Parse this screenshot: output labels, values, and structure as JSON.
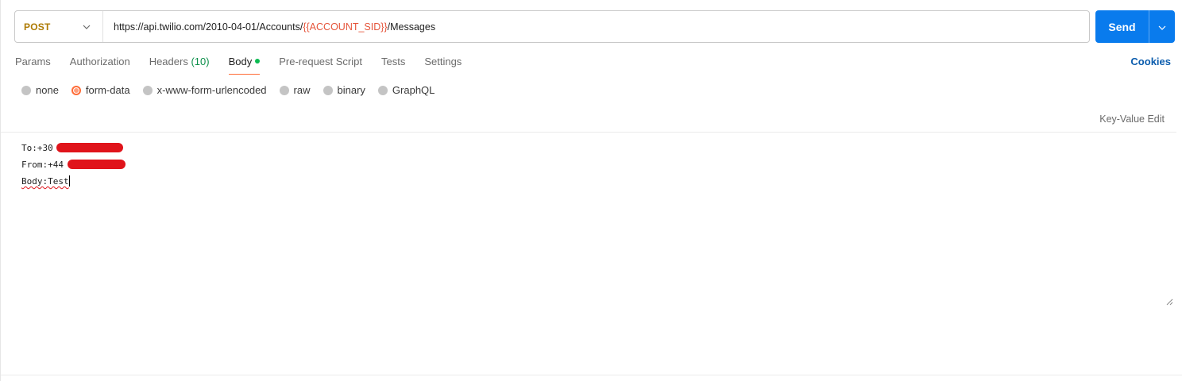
{
  "request": {
    "method": "POST",
    "url_prefix": "https://api.twilio.com/2010-04-01/Accounts/",
    "url_variable": "{{ACCOUNT_SID}}",
    "url_suffix": "/Messages",
    "send_label": "Send"
  },
  "tabs": [
    {
      "label": "Params"
    },
    {
      "label": "Authorization"
    },
    {
      "label": "Headers",
      "count": "(10)"
    },
    {
      "label": "Body"
    },
    {
      "label": "Pre-request Script"
    },
    {
      "label": "Tests"
    },
    {
      "label": "Settings"
    }
  ],
  "active_tab": "Body",
  "cookies_label": "Cookies",
  "body_modes": [
    {
      "label": "none"
    },
    {
      "label": "form-data"
    },
    {
      "label": "x-www-form-urlencoded"
    },
    {
      "label": "raw"
    },
    {
      "label": "binary"
    },
    {
      "label": "GraphQL"
    }
  ],
  "selected_body_mode": "form-data",
  "key_value_edit_label": "Key-Value Edit",
  "bulk_edit": {
    "line1": "To:+30",
    "line2": "From:+44",
    "line3": "Body:Test"
  },
  "colors": {
    "method": "#ad7a03",
    "variable": "#e5553b",
    "send_button": "#097bed",
    "active_tab_underline": "#ff6c37",
    "body_dot": "#0cbb52",
    "redaction": "#e0141b"
  }
}
